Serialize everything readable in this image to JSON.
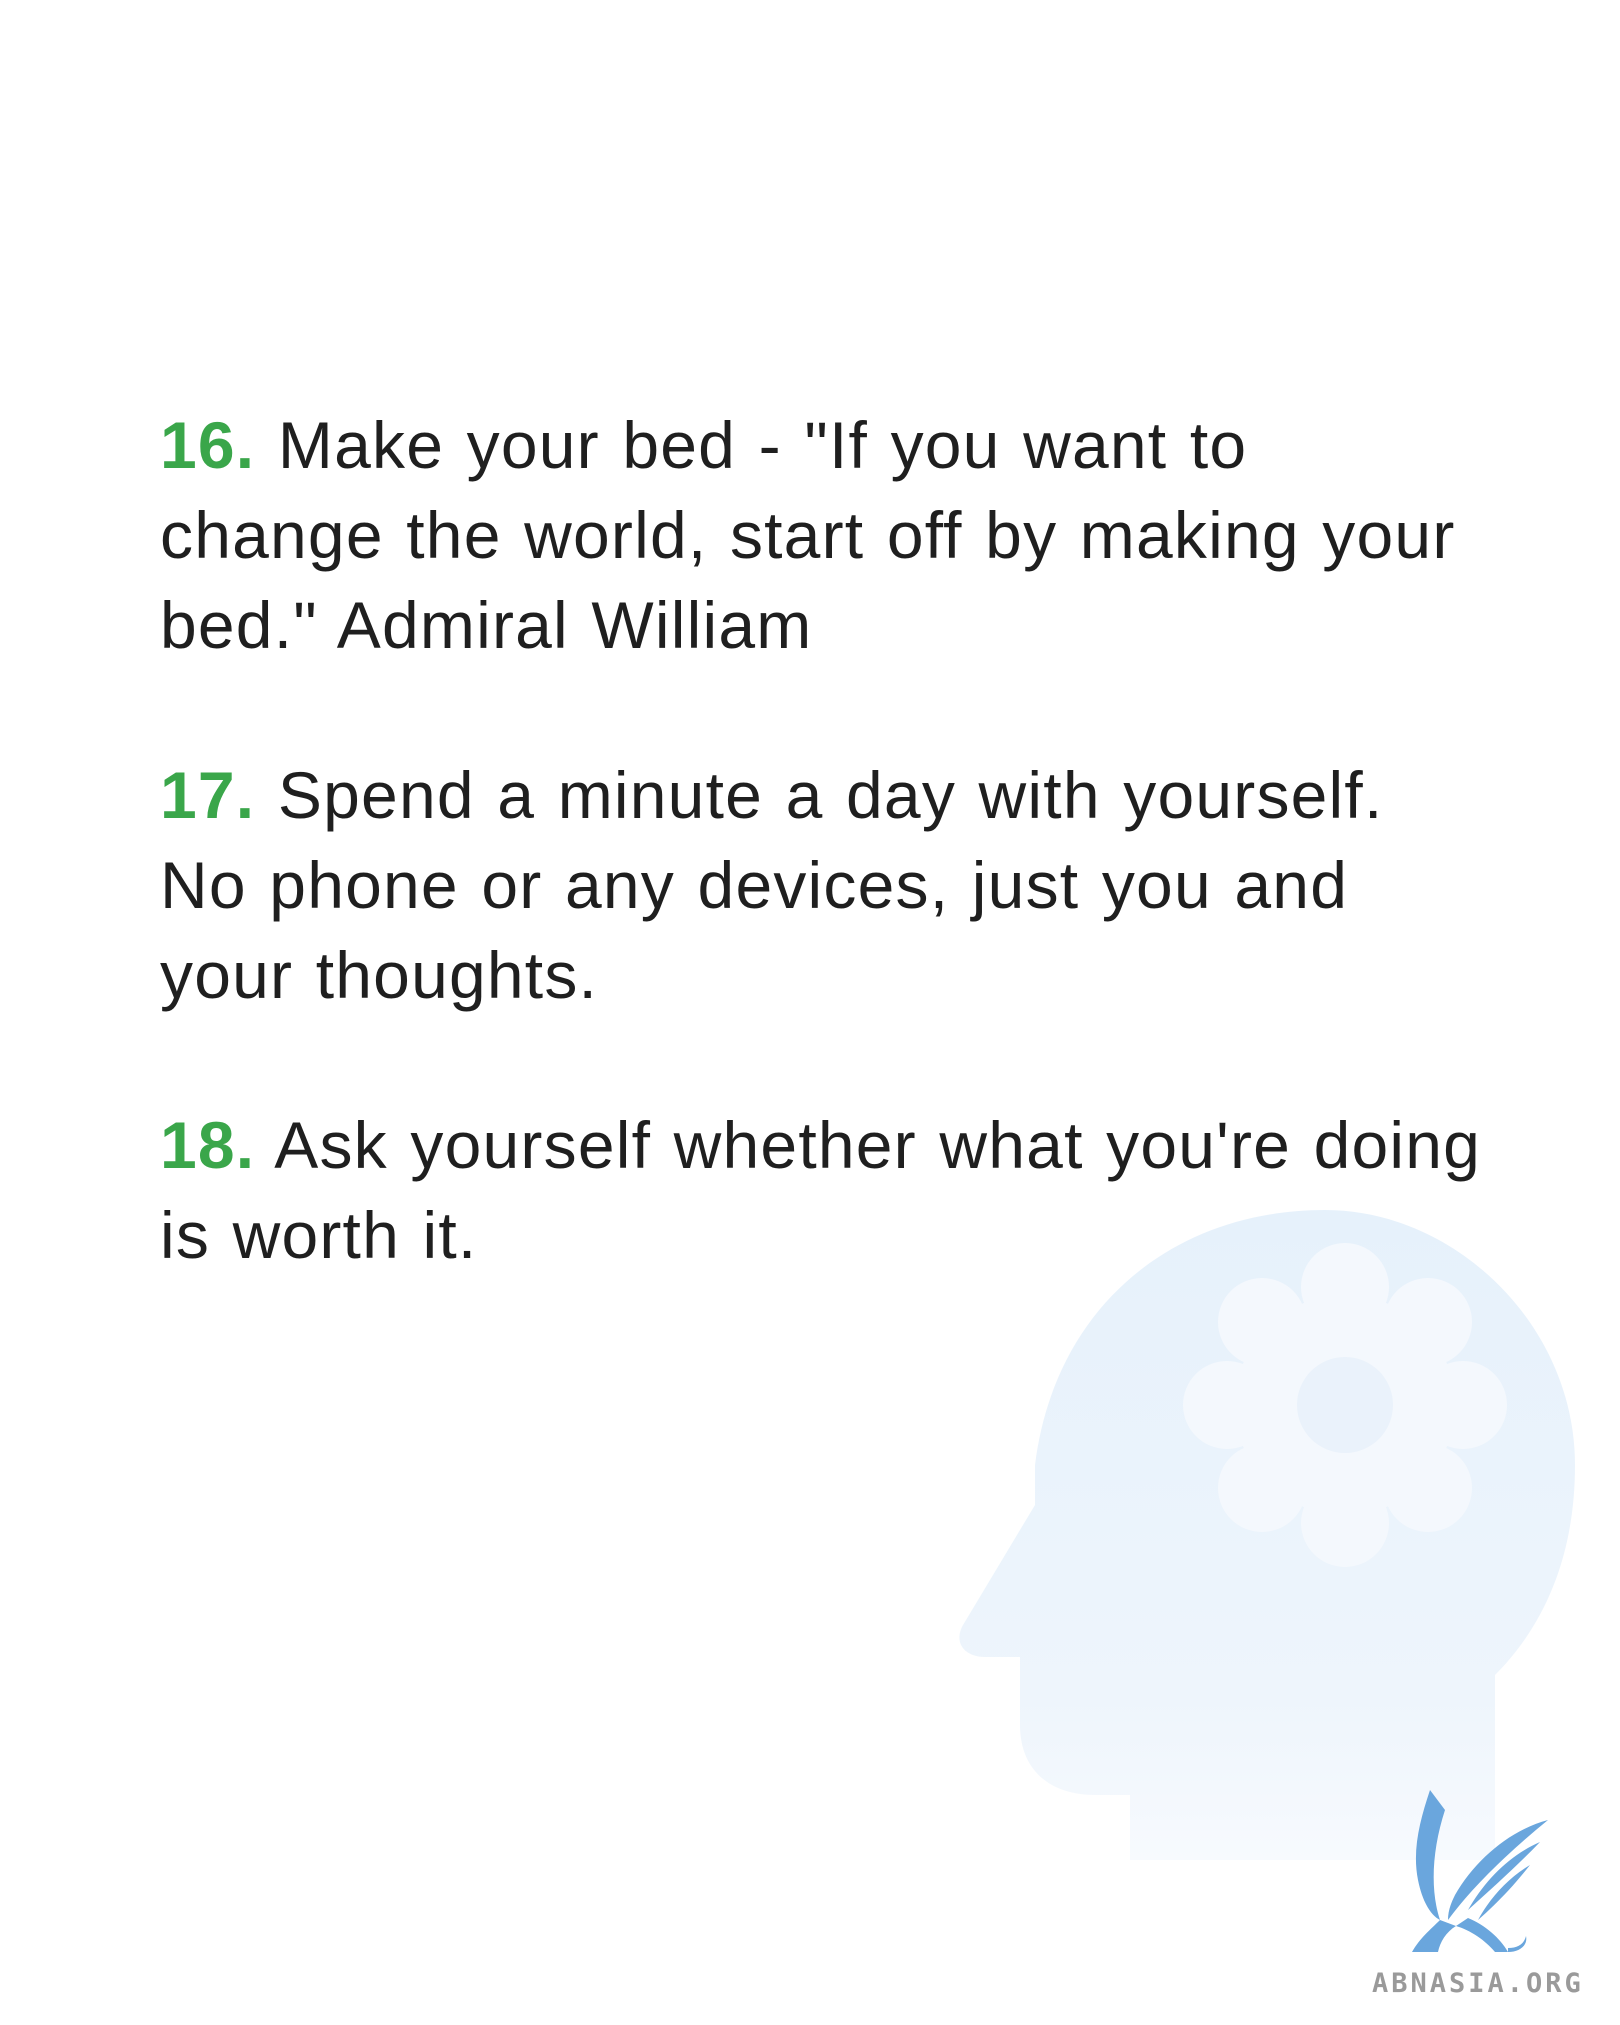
{
  "tips": [
    {
      "number": "16.",
      "text": "Make your bed - \"If you want to change the world, start off by making your bed.\" Admiral William"
    },
    {
      "number": "17.",
      "text": "Spend a minute a day with yourself. No phone or any devices, just you and your thoughts."
    },
    {
      "number": "18.",
      "text": "Ask yourself whether what you're doing is worth it."
    }
  ],
  "illustration": {
    "icon": "head-with-gear-icon"
  },
  "watermark": {
    "icon": "griffin-logo-icon",
    "text": "ABNASIA.ORG"
  },
  "colors": {
    "number_accent": "#3aa64a",
    "body_text": "#1f1f1f",
    "illustration_fill": "#e8f2fb",
    "watermark_logo": "#6aa6dd",
    "watermark_text": "#9a9a9a"
  }
}
